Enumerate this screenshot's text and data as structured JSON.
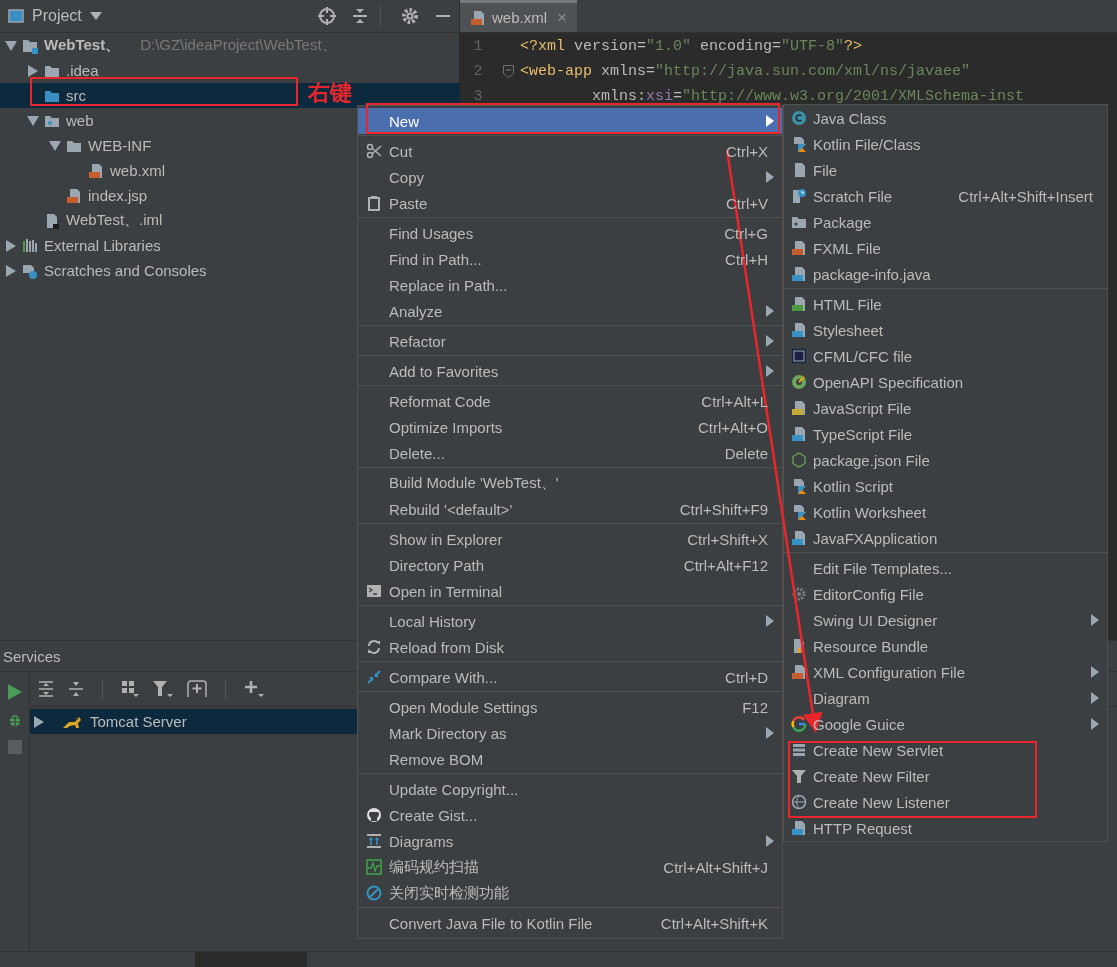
{
  "project_panel": {
    "title": "Project",
    "tree": [
      {
        "label": "WebTest、",
        "hint": "D:\\GZ\\ideaProject\\WebTest、",
        "kind": "module",
        "expanded": true,
        "selected": false,
        "children": [
          {
            "label": ".idea",
            "kind": "folder",
            "expanded": false,
            "selected": false
          },
          {
            "label": "src",
            "kind": "source-folder",
            "selected": true
          },
          {
            "label": "web",
            "kind": "web-folder",
            "expanded": true,
            "selected": false,
            "children": [
              {
                "label": "WEB-INF",
                "kind": "folder",
                "expanded": true,
                "selected": false,
                "children": [
                  {
                    "label": "web.xml",
                    "kind": "xml-file",
                    "selected": false
                  }
                ]
              },
              {
                "label": "index.jsp",
                "kind": "jsp-file",
                "selected": false
              }
            ]
          },
          {
            "label": "WebTest、.iml",
            "kind": "module-file",
            "selected": false
          }
        ]
      },
      {
        "label": "External Libraries",
        "kind": "libraries",
        "expanded": false,
        "selected": false
      },
      {
        "label": "Scratches and Consoles",
        "kind": "scratches",
        "expanded": false,
        "selected": false
      }
    ]
  },
  "editor": {
    "tab": {
      "label": "web.xml",
      "close": "×"
    },
    "lines": [
      {
        "number": "1",
        "segments": [
          {
            "kind": "tag",
            "text": "<?xml"
          },
          {
            "kind": "attr",
            "text": " version="
          },
          {
            "kind": "string",
            "text": "\"1.0\""
          },
          {
            "kind": "attr",
            "text": " encoding="
          },
          {
            "kind": "string",
            "text": "\"UTF-8\""
          },
          {
            "kind": "tag",
            "text": "?>"
          }
        ]
      },
      {
        "number": "2",
        "segments": [
          {
            "kind": "tag",
            "text": "<web-app"
          },
          {
            "kind": "attr",
            "text": " xmlns="
          },
          {
            "kind": "string",
            "text": "\"http://java.sun.com/xml/ns/javaee\""
          }
        ]
      },
      {
        "number": "3",
        "segments": [
          {
            "kind": "attr",
            "text": "        xmlns:"
          },
          {
            "kind": "ns",
            "text": "xsi"
          },
          {
            "kind": "attr",
            "text": "="
          },
          {
            "kind": "string",
            "text": "\"http://www.w3.org/2001/XMLSchema-inst"
          }
        ]
      }
    ]
  },
  "services": {
    "title": "Services",
    "tree": [
      {
        "label": "Tomcat Server",
        "selected": true
      }
    ]
  },
  "annotation": {
    "label": "右键"
  },
  "context_menu": {
    "groups": [
      {
        "items": [
          {
            "label": "New",
            "submenu": true,
            "selected": true
          }
        ]
      },
      {
        "items": [
          {
            "label": "Cut",
            "shortcut": "Ctrl+X",
            "submenu": false,
            "selected": false
          },
          {
            "label": "Copy",
            "submenu": true,
            "selected": false
          },
          {
            "label": "Paste",
            "shortcut": "Ctrl+V",
            "submenu": false,
            "selected": false
          }
        ]
      },
      {
        "items": [
          {
            "label": "Find Usages",
            "shortcut": "Ctrl+G",
            "submenu": false,
            "selected": false
          },
          {
            "label": "Find in Path...",
            "shortcut": "Ctrl+H",
            "submenu": false,
            "selected": false
          },
          {
            "label": "Replace in Path...",
            "submenu": false,
            "selected": false
          },
          {
            "label": "Analyze",
            "submenu": true,
            "selected": false
          }
        ]
      },
      {
        "items": [
          {
            "label": "Refactor",
            "submenu": true,
            "selected": false
          }
        ]
      },
      {
        "items": [
          {
            "label": "Add to Favorites",
            "submenu": true,
            "selected": false
          }
        ]
      },
      {
        "items": [
          {
            "label": "Reformat Code",
            "shortcut": "Ctrl+Alt+L",
            "submenu": false,
            "selected": false
          },
          {
            "label": "Optimize Imports",
            "shortcut": "Ctrl+Alt+O",
            "submenu": false,
            "selected": false
          },
          {
            "label": "Delete...",
            "shortcut": "Delete",
            "submenu": false,
            "selected": false
          }
        ]
      },
      {
        "items": [
          {
            "label": "Build Module 'WebTest、'",
            "submenu": false,
            "selected": false
          },
          {
            "label": "Rebuild '<default>'",
            "shortcut": "Ctrl+Shift+F9",
            "submenu": false,
            "selected": false
          }
        ]
      },
      {
        "items": [
          {
            "label": "Show in Explorer",
            "shortcut": "Ctrl+Shift+X",
            "submenu": false,
            "selected": false
          },
          {
            "label": "Directory Path",
            "shortcut": "Ctrl+Alt+F12",
            "submenu": false,
            "selected": false
          },
          {
            "label": "Open in Terminal",
            "submenu": false,
            "selected": false
          }
        ]
      },
      {
        "items": [
          {
            "label": "Local History",
            "submenu": true,
            "selected": false
          },
          {
            "label": "Reload from Disk",
            "submenu": false,
            "selected": false
          }
        ]
      },
      {
        "items": [
          {
            "label": "Compare With...",
            "shortcut": "Ctrl+D",
            "submenu": false,
            "selected": false
          }
        ]
      },
      {
        "items": [
          {
            "label": "Open Module Settings",
            "shortcut": "F12",
            "submenu": false,
            "selected": false
          },
          {
            "label": "Mark Directory as",
            "submenu": true,
            "selected": false
          },
          {
            "label": "Remove BOM",
            "submenu": false,
            "selected": false
          }
        ]
      },
      {
        "items": [
          {
            "label": "Update Copyright...",
            "submenu": false,
            "selected": false
          },
          {
            "label": "Create Gist...",
            "submenu": false,
            "selected": false
          },
          {
            "label": "Diagrams",
            "submenu": true,
            "selected": false
          },
          {
            "label": "编码规约扫描",
            "shortcut": "Ctrl+Alt+Shift+J",
            "submenu": false,
            "selected": false
          },
          {
            "label": "关闭实时检测功能",
            "submenu": false,
            "selected": false
          }
        ]
      },
      {
        "items": [
          {
            "label": "Convert Java File to Kotlin File",
            "shortcut": "Ctrl+Alt+Shift+K",
            "submenu": false,
            "selected": false
          }
        ]
      }
    ]
  },
  "new_submenu": {
    "groups": [
      {
        "items": [
          {
            "label": "Java Class",
            "submenu": false
          },
          {
            "label": "Kotlin File/Class",
            "submenu": false
          },
          {
            "label": "File",
            "submenu": false
          },
          {
            "label": "Scratch File",
            "shortcut": "Ctrl+Alt+Shift+Insert",
            "submenu": false
          },
          {
            "label": "Package",
            "submenu": false
          },
          {
            "label": "FXML File",
            "submenu": false
          },
          {
            "label": "package-info.java",
            "submenu": false
          }
        ]
      },
      {
        "items": [
          {
            "label": "HTML File",
            "submenu": false
          },
          {
            "label": "Stylesheet",
            "submenu": false
          },
          {
            "label": "CFML/CFC file",
            "submenu": false
          },
          {
            "label": "OpenAPI Specification",
            "submenu": false
          },
          {
            "label": "JavaScript File",
            "submenu": false
          },
          {
            "label": "TypeScript File",
            "submenu": false
          },
          {
            "label": "package.json File",
            "submenu": false
          },
          {
            "label": "Kotlin Script",
            "submenu": false
          },
          {
            "label": "Kotlin Worksheet",
            "submenu": false
          },
          {
            "label": "JavaFXApplication",
            "submenu": false
          }
        ]
      },
      {
        "items": [
          {
            "label": "Edit File Templates...",
            "submenu": false
          },
          {
            "label": "EditorConfig File",
            "submenu": false
          },
          {
            "label": "Swing UI Designer",
            "submenu": true
          },
          {
            "label": "Resource Bundle",
            "submenu": false
          },
          {
            "label": "XML Configuration File",
            "submenu": true
          },
          {
            "label": "Diagram",
            "submenu": true
          },
          {
            "label": "Google Guice",
            "submenu": true
          },
          {
            "label": "Create New Servlet",
            "submenu": false
          },
          {
            "label": "Create New Filter",
            "submenu": false
          },
          {
            "label": "Create New Listener",
            "submenu": false
          },
          {
            "label": "HTTP Request",
            "submenu": false
          }
        ]
      }
    ]
  }
}
